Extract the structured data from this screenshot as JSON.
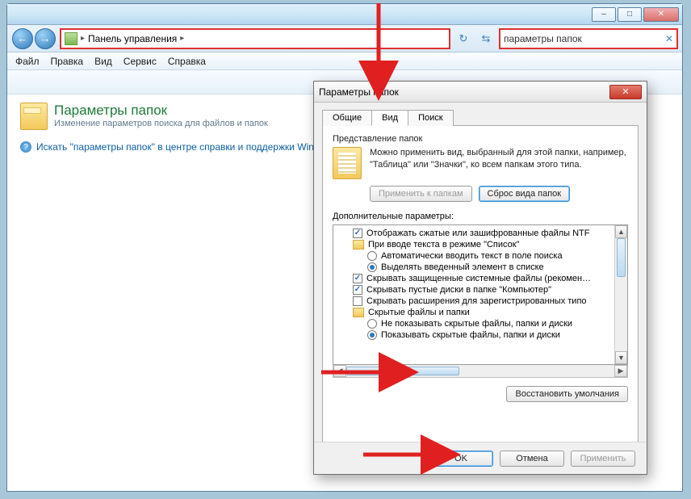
{
  "window": {
    "min_tip": "–",
    "max_tip": "□",
    "close_tip": "✕"
  },
  "nav": {
    "back": "←",
    "fwd": "→",
    "crumb_root": "Панель управления",
    "crumb_sep": "▸",
    "refresh_icon": "↻",
    "split_icon": "⇆",
    "search_value": "параметры папок",
    "search_clear": "✕"
  },
  "menu": {
    "file": "Файл",
    "edit": "Правка",
    "view": "Вид",
    "tools": "Сервис",
    "help": "Справка"
  },
  "header": {
    "title": "Параметры папок",
    "subtitle": "Изменение параметров поиска для файлов и папок"
  },
  "help_link": "Искать \"параметры папок\" в центре справки и поддержки Win",
  "dialog": {
    "title": "Параметры папок",
    "tabs": {
      "general": "Общие",
      "view": "Вид",
      "search": "Поиск"
    },
    "rep_group": "Представление папок",
    "rep_text": "Можно применить вид, выбранный для этой папки, например, \"Таблица\" или \"Значки\", ко всем папкам этого типа.",
    "apply_folders": "Применить к папкам",
    "reset_view": "Сброс вида папок",
    "adv_label": "Дополнительные параметры:",
    "items": {
      "i0": "Отображать сжатые или зашифрованные файлы NTF",
      "i1": "При вводе текста в режиме \"Список\"",
      "i1a": "Автоматически вводить текст в поле поиска",
      "i1b": "Выделять введенный элемент в списке",
      "i2": "Скрывать защищенные системные файлы (рекомен…",
      "i3": "Скрывать пустые диски в папке \"Компьютер\"",
      "i4": "Скрывать расширения для зарегистрированных типо",
      "i5": "Скрытые файлы и папки",
      "i5a": "Не показывать скрытые файлы, папки и диски",
      "i5b": "Показывать скрытые файлы, папки и диски"
    },
    "restore": "Восстановить умолчания",
    "ok": "OK",
    "cancel": "Отмена",
    "apply": "Применить"
  }
}
